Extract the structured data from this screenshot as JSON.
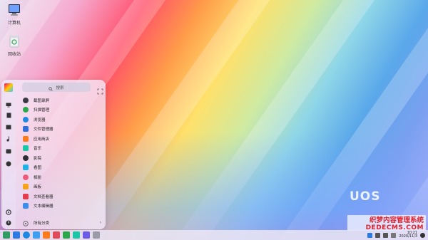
{
  "desktop": {
    "icons": [
      {
        "label": "计算机"
      },
      {
        "label": "回收站"
      }
    ],
    "logo": "UOS"
  },
  "launcher": {
    "search": {
      "placeholder": "搜索"
    },
    "apps": [
      {
        "label": "截图录屏",
        "color": "#3a3a44"
      },
      {
        "label": "扫描管理",
        "color": "#2aa84a"
      },
      {
        "label": "浏览器",
        "color": "#1e88e5"
      },
      {
        "label": "文件管理器",
        "color": "#2f6fdc"
      },
      {
        "label": "应用商店",
        "color": "#ff7a1a"
      },
      {
        "label": "音乐",
        "color": "#19c6a6"
      },
      {
        "label": "影院",
        "color": "#2c2c34"
      },
      {
        "label": "看图",
        "color": "#1bb3e8"
      },
      {
        "label": "相册",
        "color": "#f05a7a"
      },
      {
        "label": "画板",
        "color": "#f4a31a"
      },
      {
        "label": "文档查看器",
        "color": "#e23b4b"
      },
      {
        "label": "文本编辑器",
        "color": "#3a8ef0"
      }
    ],
    "all_categories": "所有分类",
    "side_icons": [
      "computer-icon",
      "document-icon",
      "image-icon",
      "music-icon",
      "video-icon",
      "download-icon",
      "settings-icon",
      "power-icon"
    ]
  },
  "dock": {
    "items": [
      "#2e9d62",
      "#2c7be5",
      "#1e88e5",
      "#3ca0f0",
      "#ff7a1a",
      "#e04a5a",
      "#2aa84a",
      "#19c6a6",
      "#6c5ce7",
      "#9a9aa8"
    ]
  },
  "tray": {
    "time": "10:21",
    "date": "2020/11/3"
  },
  "watermark": {
    "line1": "织梦内容管理系统",
    "line2": "DEDECMS.COM"
  }
}
